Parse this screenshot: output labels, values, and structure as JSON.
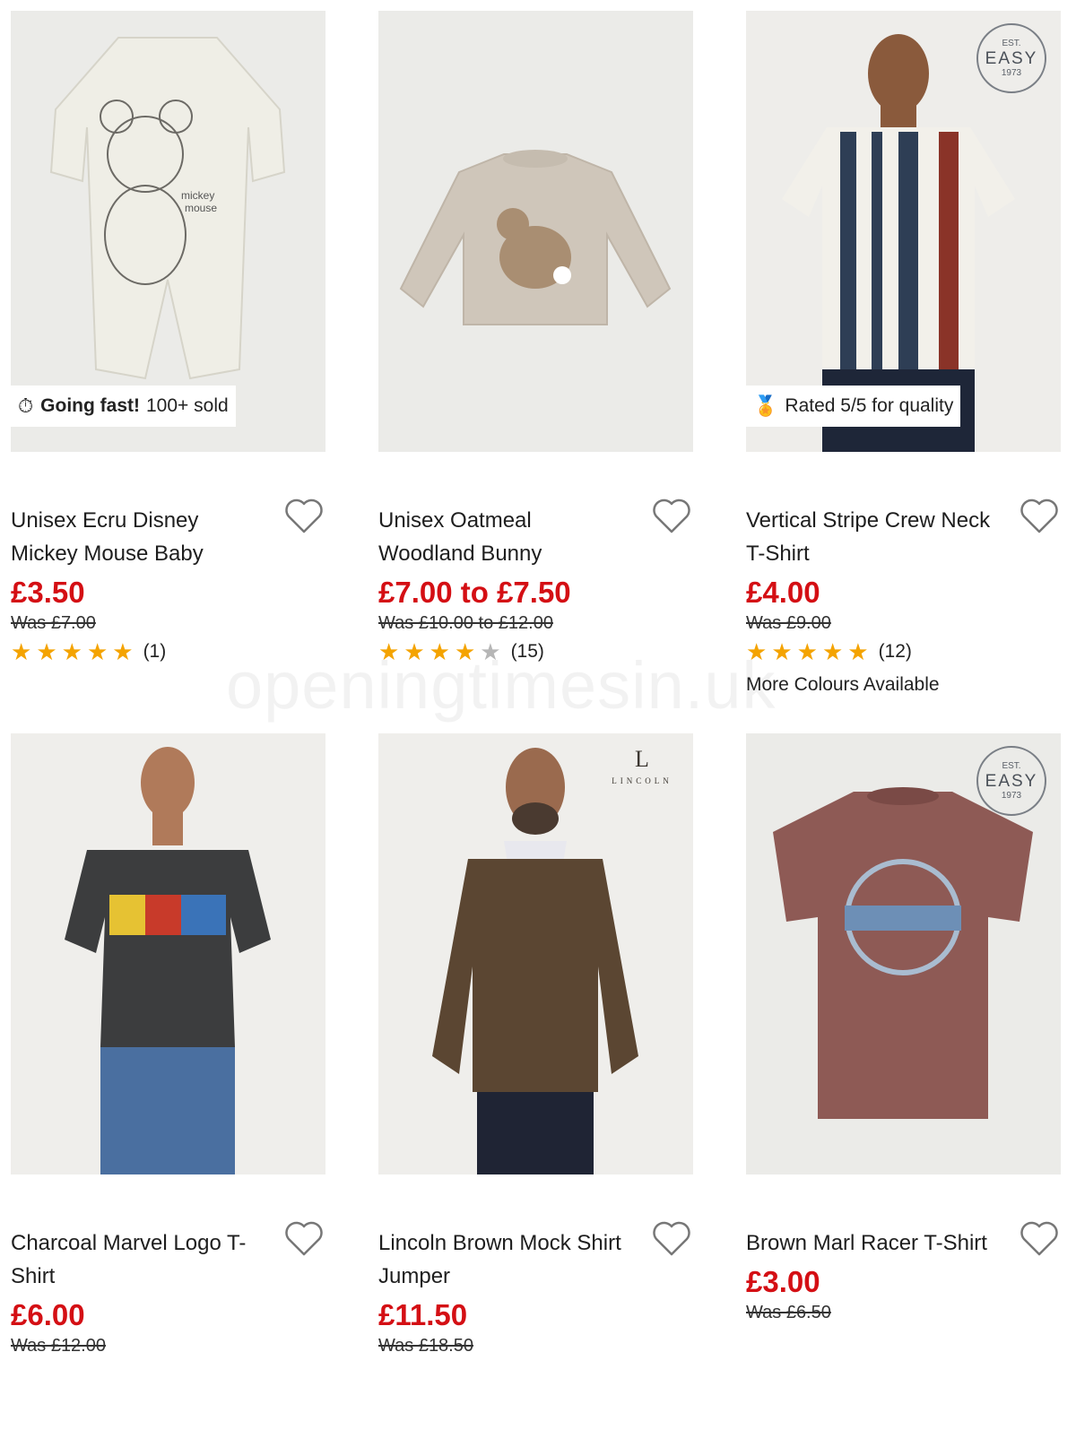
{
  "watermark": "openingtimesin.uk",
  "products": [
    {
      "title": "Unisex Ecru Disney Mickey Mouse Baby",
      "price": "£3.50",
      "was": "Was £7.00",
      "rating": 5,
      "review_count": "(1)",
      "badge": {
        "icon": "stopwatch-icon",
        "strong": "Going fast!",
        "text": "100+ sold"
      }
    },
    {
      "title": "Unisex Oatmeal Woodland Bunny",
      "price": "£7.00 to £7.50",
      "was": "Was £10.00 to £12.00",
      "rating": 4,
      "review_count": "(15)"
    },
    {
      "title": "Vertical Stripe Crew Neck T-Shirt",
      "price": "£4.00",
      "was": "Was £9.00",
      "rating": 5,
      "review_count": "(12)",
      "badge": {
        "icon": "medal-icon",
        "strong": "",
        "text": "Rated 5/5 for quality"
      },
      "brand_mark": {
        "top": "EST.",
        "main": "EASY",
        "year": "1973"
      },
      "extra": "More Colours Available"
    },
    {
      "title": "Charcoal Marvel Logo T-Shirt",
      "price": "£6.00",
      "was": "Was £12.00"
    },
    {
      "title": "Lincoln Brown Mock Shirt Jumper",
      "price": "£11.50",
      "was": "Was £18.50",
      "brand_mark": {
        "letter": "L",
        "word": "LINCOLN"
      }
    },
    {
      "title": "Brown Marl Racer T-Shirt",
      "price": "£3.00",
      "was": "Was £6.50",
      "brand_mark": {
        "top": "EST.",
        "main": "EASY",
        "year": "1973"
      }
    }
  ],
  "colors": {
    "price_red": "#d40f14",
    "star_gold": "#f4a300",
    "image_bg": "#ebebe8"
  }
}
